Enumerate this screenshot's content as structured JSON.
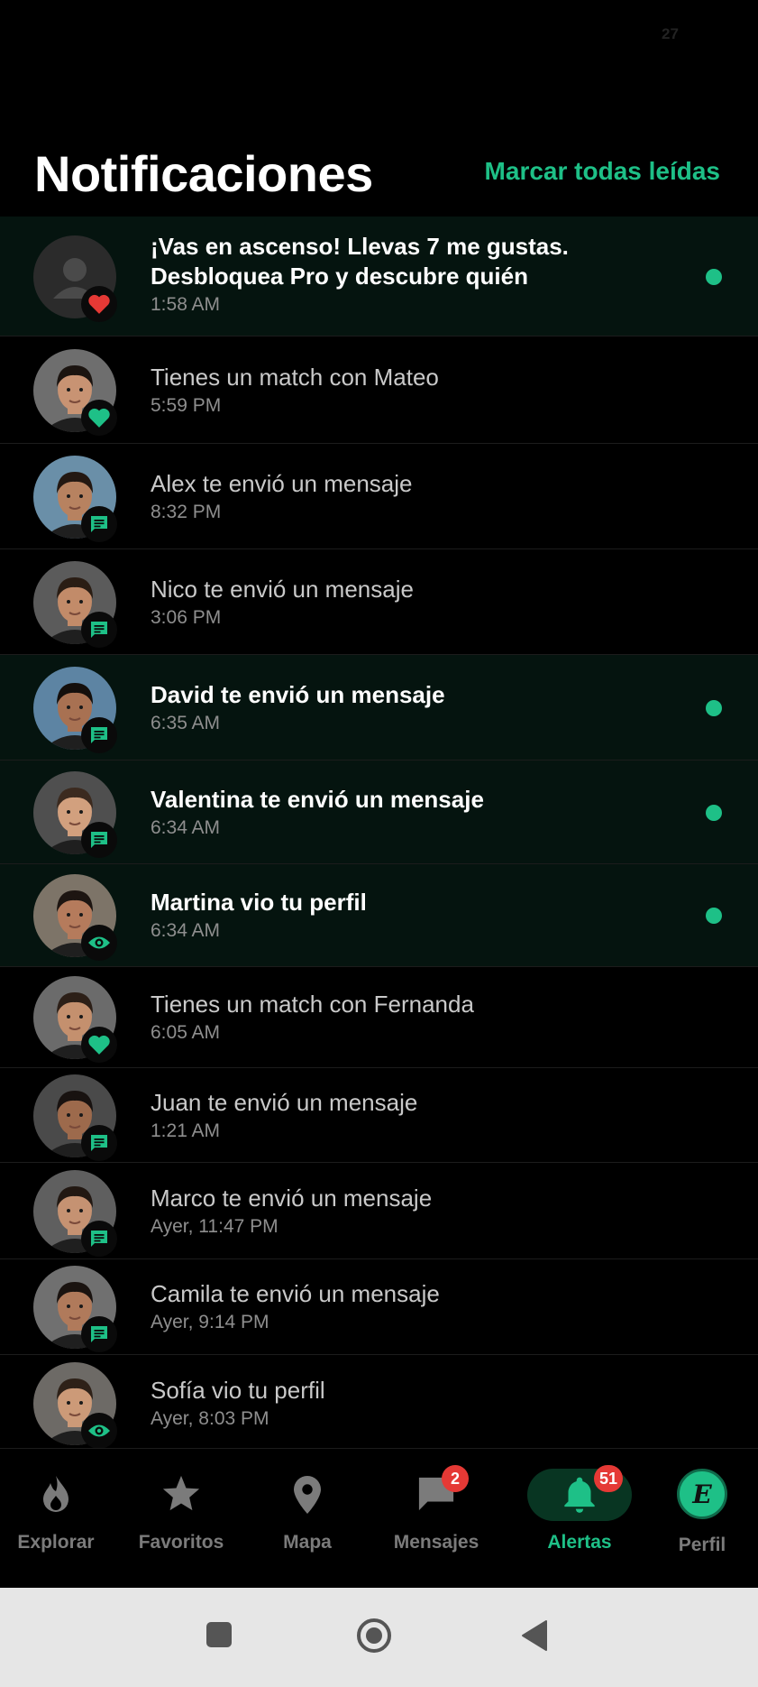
{
  "status_bar": {
    "number": "27"
  },
  "header": {
    "title": "Notificaciones",
    "mark_all": "Marcar todas leídas"
  },
  "notifications": [
    {
      "text": "¡Vas en ascenso! Llevas 7 me gustas. Desbloquea Pro y descubre quién",
      "time": "1:58 AM",
      "unread": true,
      "type": "like",
      "avatar": "placeholder"
    },
    {
      "text": "Tienes un match con Mateo",
      "time": "5:59 PM",
      "unread": false,
      "type": "match",
      "avatar": "photo"
    },
    {
      "text": "Alex te envió un mensaje",
      "time": "8:32 PM",
      "unread": false,
      "type": "message",
      "avatar": "photo"
    },
    {
      "text": "Nico te envió un mensaje",
      "time": "3:06 PM",
      "unread": false,
      "type": "message",
      "avatar": "photo"
    },
    {
      "text": "David  te envió un mensaje",
      "time": "6:35 AM",
      "unread": true,
      "type": "message",
      "avatar": "photo"
    },
    {
      "text": "Valentina  te envió un mensaje",
      "time": "6:34 AM",
      "unread": true,
      "type": "message",
      "avatar": "photo"
    },
    {
      "text": "Martina  vio tu perfil",
      "time": "6:34 AM",
      "unread": true,
      "type": "view",
      "avatar": "photo"
    },
    {
      "text": "Tienes un match con Fernanda",
      "time": "6:05 AM",
      "unread": false,
      "type": "match",
      "avatar": "photo"
    },
    {
      "text": "Juan te envió un mensaje",
      "time": "1:21 AM",
      "unread": false,
      "type": "message",
      "avatar": "photo"
    },
    {
      "text": "Marco te envió un mensaje",
      "time": "Ayer, 11:47 PM",
      "unread": false,
      "type": "message",
      "avatar": "photo"
    },
    {
      "text": "Camila  te envió un mensaje",
      "time": "Ayer, 9:14 PM",
      "unread": false,
      "type": "message",
      "avatar": "photo"
    },
    {
      "text": "Sofía  vio tu perfil",
      "time": "Ayer, 8:03 PM",
      "unread": false,
      "type": "view",
      "avatar": "photo"
    }
  ],
  "nav": [
    {
      "label": "Explorar",
      "icon": "flame-icon"
    },
    {
      "label": "Favoritos",
      "icon": "star-icon"
    },
    {
      "label": "Mapa",
      "icon": "map-pin-icon"
    },
    {
      "label": "Mensajes",
      "icon": "chat-icon",
      "count": "2"
    },
    {
      "label": "Alertas",
      "icon": "bell-icon",
      "count": "51",
      "active": true
    },
    {
      "label": "Perfil",
      "icon": "profile-icon",
      "initial": "E"
    }
  ],
  "colors": {
    "accent": "#1ec087",
    "badge": "#e53935",
    "unread_bg": "#05140f",
    "like": "#e53935"
  }
}
